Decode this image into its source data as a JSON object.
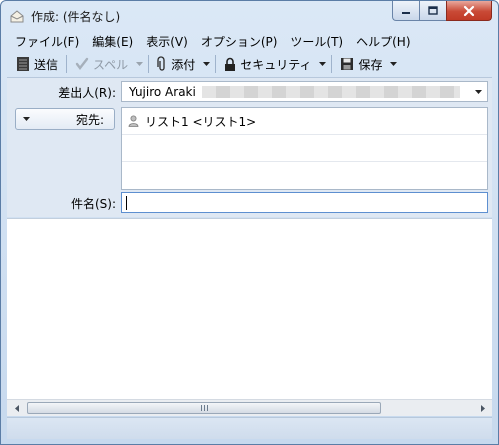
{
  "window": {
    "title": "作成: (件名なし)"
  },
  "menu": [
    {
      "label": "ファイル(F)"
    },
    {
      "label": "編集(E)"
    },
    {
      "label": "表示(V)"
    },
    {
      "label": "オプション(P)"
    },
    {
      "label": "ツール(T)"
    },
    {
      "label": "ヘルプ(H)"
    }
  ],
  "toolbar": {
    "send_label": "送信",
    "spell_label": "スペル",
    "attach_label": "添付",
    "security_label": "セキュリティ",
    "save_label": "保存"
  },
  "header": {
    "from_label": "差出人(R):",
    "from_value": "Yujiro Araki",
    "to_type_label": "宛先:",
    "recipients": [
      {
        "text": "リスト1 <リスト1>"
      },
      {
        "text": ""
      },
      {
        "text": ""
      }
    ],
    "subject_label": "件名(S):",
    "subject_value": ""
  },
  "colors": {
    "chrome": "#c7d9ee",
    "close_button": "#c94a36",
    "header_pane": "#dfe8f3",
    "focus_border": "#5d8fd0"
  },
  "icons": [
    "app-icon",
    "minimize-icon",
    "maximize-icon",
    "close-icon",
    "send-icon",
    "spell-check-icon",
    "paperclip-icon",
    "lock-icon",
    "floppy-disk-icon",
    "chevron-down-icon",
    "person-icon",
    "scroll-left-icon",
    "scroll-right-icon"
  ]
}
